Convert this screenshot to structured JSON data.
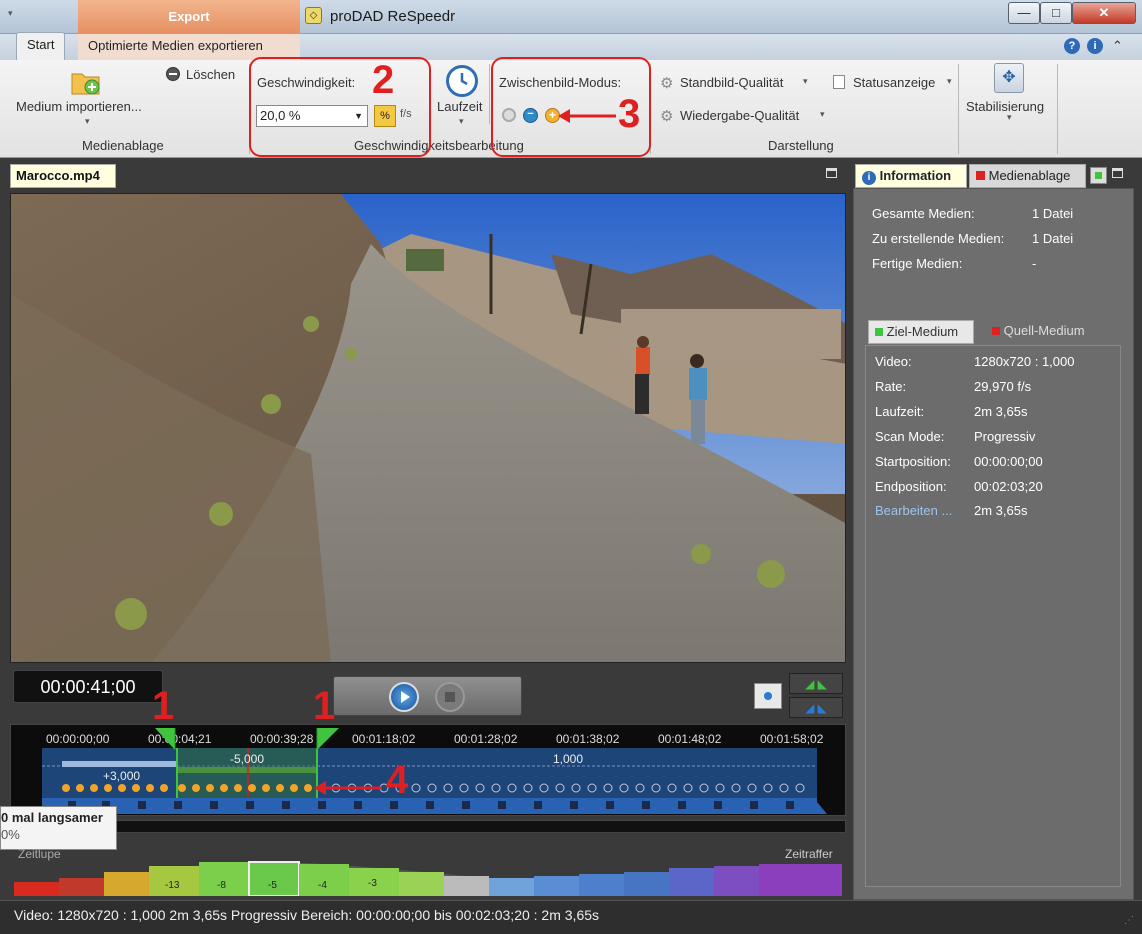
{
  "window": {
    "export_tab": "Export",
    "title": "proDAD ReSpeedr",
    "minimize": "—",
    "maximize": "□",
    "close": "✕"
  },
  "ribbon_tabs": {
    "start": "Start",
    "export_media": "Optimierte Medien exportieren"
  },
  "ribbon": {
    "import_label": "Medium importieren...",
    "delete_label": "Löschen",
    "group_media": "Medienablage",
    "speed_label": "Geschwindigkeit:",
    "speed_value": "20,0 %",
    "percent_btn": "%",
    "fps_btn": "f/s",
    "runtime_label": "Laufzeit",
    "interframe_label": "Zwischenbild-Modus:",
    "group_speed": "Geschwindigkeitsbearbeitung",
    "still_quality": "Standbild-Qualität",
    "playback_quality": "Wiedergabe-Qualität",
    "status_display": "Statusanzeige",
    "group_display": "Darstellung",
    "stabilize": "Stabilisierung"
  },
  "annotations": {
    "n1": "1",
    "n2": "2",
    "n3": "3",
    "n4": "4",
    "color": "#e02020"
  },
  "video": {
    "filename": "Marocco.mp4"
  },
  "info_panel": {
    "tab_info": "Information",
    "tab_media": "Medienablage",
    "rows": [
      {
        "label": "Gesamte Medien:",
        "value": "1 Datei"
      },
      {
        "label": "Zu erstellende Medien:",
        "value": "1 Datei"
      },
      {
        "label": "Fertige Medien:",
        "value": "-"
      }
    ],
    "tab_target": "Ziel-Medium",
    "tab_source": "Quell-Medium",
    "details": [
      {
        "label": "Video:",
        "value": "1280x720 : 1,000"
      },
      {
        "label": "Rate:",
        "value": "29,970 f/s"
      },
      {
        "label": "Laufzeit:",
        "value": "2m 3,65s"
      },
      {
        "label": "Scan Mode:",
        "value": "Progressiv"
      },
      {
        "label": "Startposition:",
        "value": "00:00:00;00"
      },
      {
        "label": "Endposition:",
        "value": "00:02:03;20"
      },
      {
        "label": "Bearbeiten ...",
        "value": "2m 3,65s"
      }
    ]
  },
  "transport": {
    "timecode": "00:00:41;00"
  },
  "timeline": {
    "ticks": [
      "00:00:00;00",
      "00:00:04;21",
      "00:00:39;28",
      "00:01:18;02",
      "00:01:28;02",
      "00:01:38;02",
      "00:01:48;02",
      "00:01:58;02"
    ],
    "seg_labels": [
      "-5,000",
      "1,000",
      "+3,000"
    ]
  },
  "tooltip": {
    "line1": "0 mal langsamer",
    "line2": "0%"
  },
  "speed_scale": {
    "slow_label": "Zeitlupe",
    "fast_label": "Zeitraffer",
    "marks": [
      "-13",
      "-8",
      "-5",
      "-4",
      "-3"
    ]
  },
  "statusbar": {
    "text": "Video: 1280x720 : 1,000   2m 3,65s   Progressiv   Bereich: 00:00:00;00 bis 00:02:03;20 : 2m 3,65s"
  }
}
